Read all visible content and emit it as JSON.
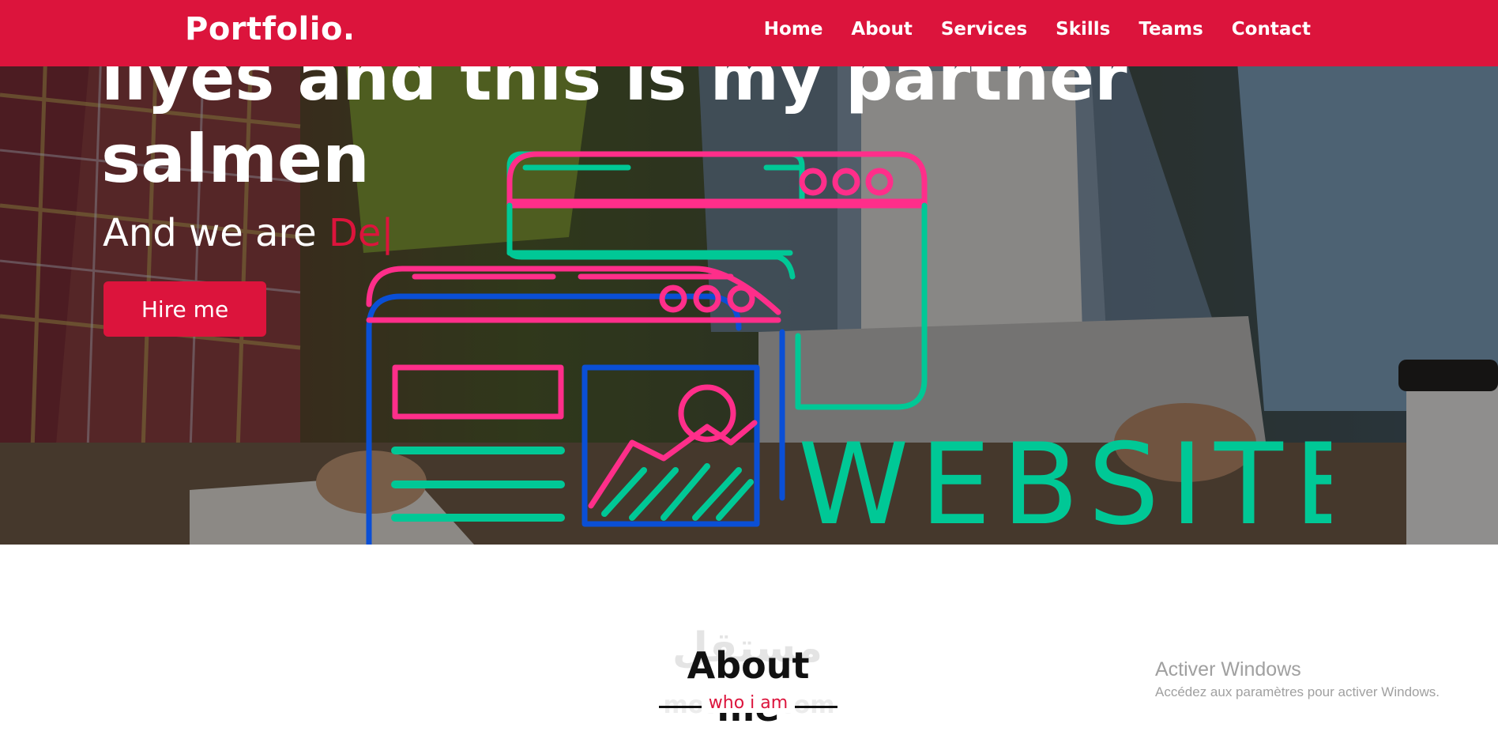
{
  "brand": {
    "logo": "Portfolio."
  },
  "nav": {
    "items": [
      {
        "label": "Home"
      },
      {
        "label": "About"
      },
      {
        "label": "Services"
      },
      {
        "label": "Skills"
      },
      {
        "label": "Teams"
      },
      {
        "label": "Contact"
      }
    ]
  },
  "hero": {
    "title": "ilyes and this is my partner salmen",
    "subtitle_prefix": "And we are ",
    "subtitle_typed": "De",
    "cursor": "|",
    "button_label": "Hire me",
    "illustration_word": "WEBSITE"
  },
  "about": {
    "title": "About me",
    "subtitle": "who i am",
    "watermark_text": "مستقل",
    "watermark_sub": "mostaql.com"
  },
  "windows_notice": {
    "title": "Activer Windows",
    "subtitle": "Accédez aux paramètres pour activer Windows."
  },
  "colors": {
    "accent": "#dc143c",
    "neon_green": "#00c896",
    "neon_pink": "#ff2e8a",
    "neon_blue": "#0a4fd6"
  }
}
